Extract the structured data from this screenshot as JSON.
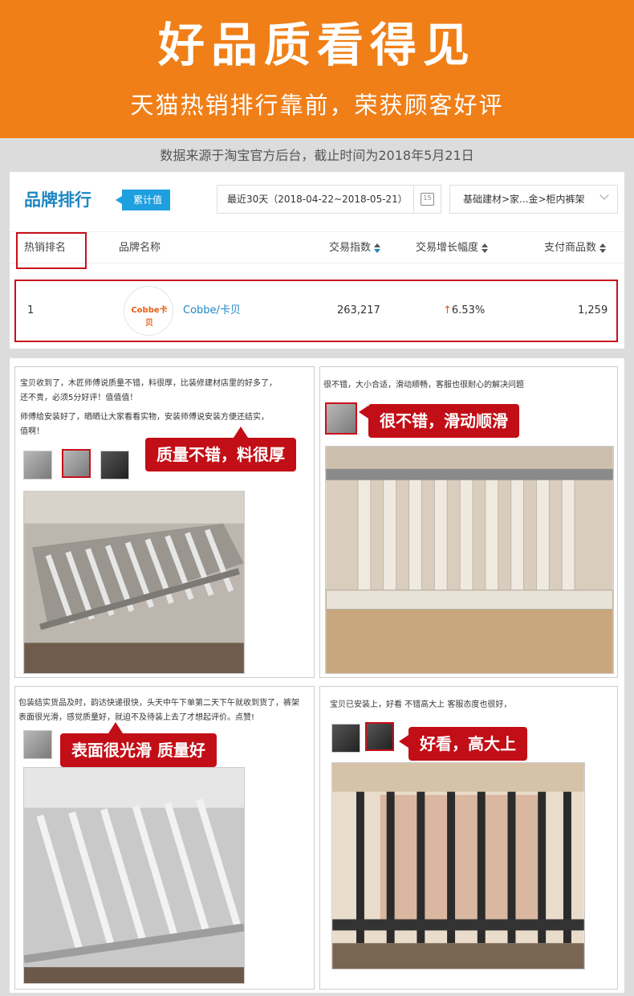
{
  "header": {
    "title": "好品质看得见",
    "subtitle": "天猫热销排行靠前，荣获顾客好评"
  },
  "source_note": "数据来源于淘宝官方后台，截止时间为2018年5月21日",
  "ranking": {
    "title": "品牌排行",
    "tag": "累计值",
    "date_range": "最近30天（2018-04-22~2018-05-21）",
    "calendar_label": "15",
    "category": "基础建材>家...金>柜内裤架",
    "columns": [
      "热销排名",
      "品牌名称",
      "交易指数",
      "交易增长幅度",
      "支付商品数"
    ],
    "row": {
      "rank": "1",
      "logo_text": "Cobbe卡贝",
      "brand": "Cobbe/卡贝",
      "trade_index": "263,217",
      "growth": "6.53%",
      "paid_items": "1,259"
    }
  },
  "reviews": [
    {
      "lines": [
        "宝贝收到了，木匠师傅说质量不错，料很厚，比装修建材店里的好多了，",
        "还不贵，必须5分好评！值值值！",
        "师傅给安装好了，晒晒让大家看看实物，安装师傅说安装方便还结实，",
        "值啊！"
      ],
      "badge": "质量不错，料很厚"
    },
    {
      "lines": [
        "很不错，大小合适，滑动顺畅，客服也很耐心的解决问题"
      ],
      "badge": "很不错，滑动顺滑"
    },
    {
      "lines": [
        "包装结实货品及时，韵达快递很快，头天中午下单第二天下午就收到货了，裤架",
        "表面很光滑，感觉质量好，就迫不及待装上去了才想起评价。点赞!"
      ],
      "badge": "表面很光滑 质量好"
    },
    {
      "lines": [
        "宝贝已安装上，好看 不错高大上 客服态度也很好，"
      ],
      "badge": "好看，高大上"
    }
  ],
  "colors": {
    "header_bg": "#f07f18",
    "accent_red": "#c20e16",
    "brand_blue": "#1d86c4"
  }
}
